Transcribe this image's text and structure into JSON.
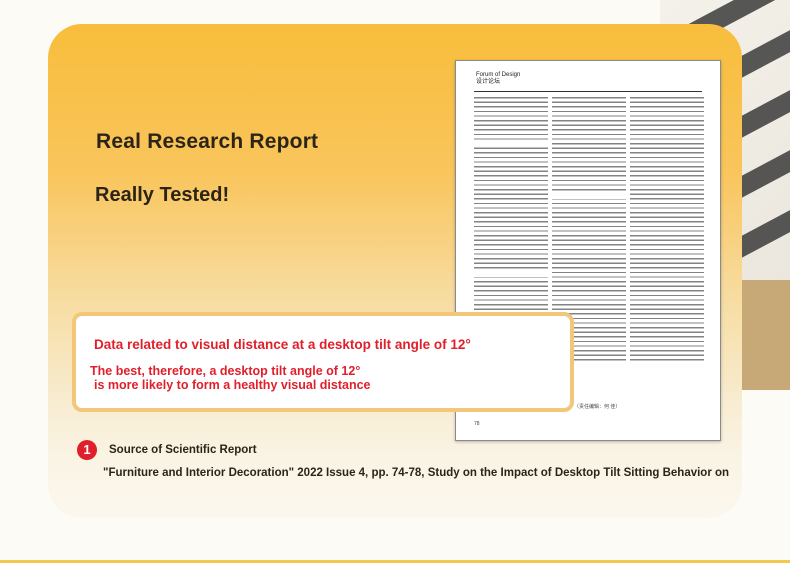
{
  "heading": "Real Research Report",
  "subheading": "Really Tested!",
  "paper": {
    "section_label": "Forum of Design",
    "section_label_cn": "设计论坛",
    "footer": "（责任编辑：何 佳）",
    "page_number": "78"
  },
  "callout": {
    "line1": "Data related to visual distance at a desktop tilt angle of 12°",
    "line2": "The best, therefore, a desktop tilt angle of 12°",
    "line3": "is more likely to form a healthy visual distance"
  },
  "source": {
    "number": "1",
    "label": "Source of Scientific Report",
    "citation": "\"Furniture and Interior Decoration\" 2022 Issue 4, pp. 74-78, Study on the Impact of Desktop Tilt Sitting Behavior on"
  },
  "colors": {
    "accent": "#f8bd3b",
    "highlight_text": "#e01f2a"
  }
}
